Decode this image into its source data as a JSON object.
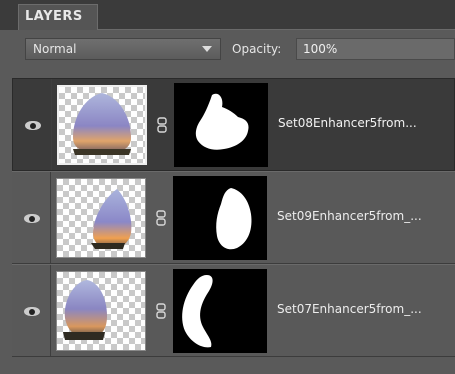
{
  "panel": {
    "tab_label": "LAYERS"
  },
  "options": {
    "blend_mode": "Normal",
    "opacity_label": "Opacity:",
    "opacity_value": "100%"
  },
  "layers": [
    {
      "name": "Set08Enhancer5from...",
      "visible": true,
      "selected": true
    },
    {
      "name": "Set09Enhancer5from_...",
      "visible": true,
      "selected": false
    },
    {
      "name": "Set07Enhancer5from_...",
      "visible": true,
      "selected": false
    }
  ],
  "icons": {
    "eye": "eye-icon",
    "link": "chain-link-icon",
    "chevron": "chevron-down-icon"
  }
}
